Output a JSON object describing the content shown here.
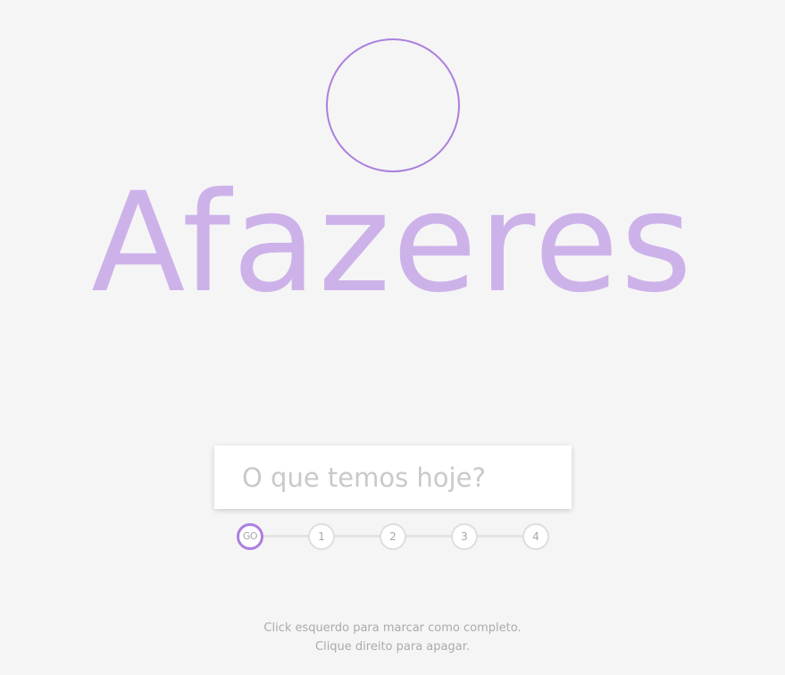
{
  "header": {
    "title": "Afazeres"
  },
  "input": {
    "placeholder": "O que temos hoje?",
    "value": ""
  },
  "steps": [
    {
      "label": "GO",
      "active": true
    },
    {
      "label": "1",
      "active": false
    },
    {
      "label": "2",
      "active": false
    },
    {
      "label": "3",
      "active": false
    },
    {
      "label": "4",
      "active": false
    }
  ],
  "footer": {
    "line1": "Click esquerdo para marcar como completo.",
    "line2": "Clique direito para apagar."
  },
  "colors": {
    "accent": "#ab7fdf",
    "title": "#cdb2ea",
    "background": "#f5f5f5"
  }
}
